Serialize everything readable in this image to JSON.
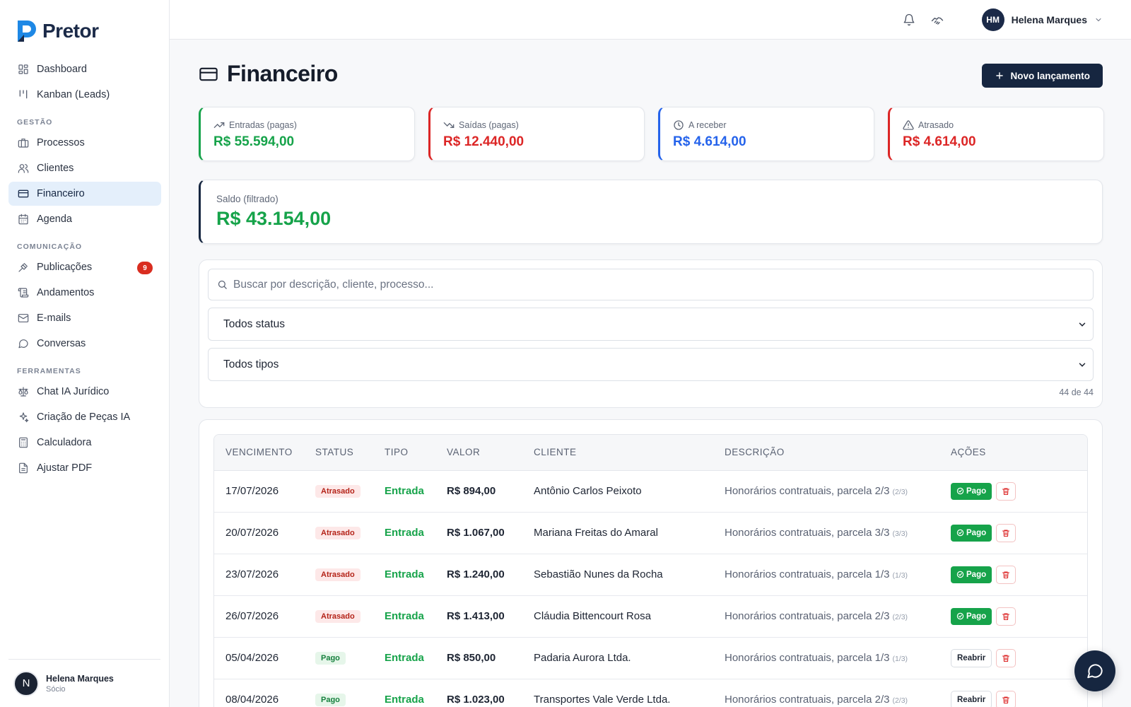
{
  "brand": {
    "name": "Pretor",
    "color": "#1e88e5"
  },
  "colors": {
    "primary": "#162640",
    "green": "#16a34a",
    "red": "#dc2626",
    "blue": "#2563eb"
  },
  "sidebar": {
    "items": [
      {
        "label": "Dashboard",
        "icon": "dashboard-icon"
      },
      {
        "label": "Kanban (Leads)",
        "icon": "kanban-icon"
      }
    ],
    "sections": [
      {
        "title": "GESTÃO",
        "items": [
          {
            "label": "Processos",
            "icon": "briefcase-icon"
          },
          {
            "label": "Clientes",
            "icon": "users-icon"
          },
          {
            "label": "Financeiro",
            "icon": "credit-card-icon",
            "active": true
          },
          {
            "label": "Agenda",
            "icon": "calendar-icon"
          }
        ]
      },
      {
        "title": "COMUNICAÇÃO",
        "items": [
          {
            "label": "Publicações",
            "icon": "gavel-icon",
            "badge": "9"
          },
          {
            "label": "Andamentos",
            "icon": "scroll-icon"
          },
          {
            "label": "E-mails",
            "icon": "mail-icon"
          },
          {
            "label": "Conversas",
            "icon": "chat-icon"
          }
        ]
      },
      {
        "title": "FERRAMENTAS",
        "items": [
          {
            "label": "Chat IA Jurídico",
            "icon": "scale-icon"
          },
          {
            "label": "Criação de Peças IA",
            "icon": "sparkles-icon"
          },
          {
            "label": "Calculadora",
            "icon": "calculator-icon"
          },
          {
            "label": "Ajustar PDF",
            "icon": "file-icon"
          }
        ]
      }
    ],
    "user": {
      "initial": "N",
      "name": "Helena Marques",
      "role": "Sócio"
    }
  },
  "topbar": {
    "user_initials": "HM",
    "user_name": "Helena Marques"
  },
  "page": {
    "title": "Financeiro",
    "new_button": "Novo lançamento"
  },
  "stats": [
    {
      "label": "Entradas (pagas)",
      "value": "R$ 55.594,00",
      "color": "#16a34a",
      "icon": "trending-up-icon"
    },
    {
      "label": "Saídas (pagas)",
      "value": "R$ 12.440,00",
      "color": "#dc2626",
      "icon": "trending-down-icon"
    },
    {
      "label": "A receber",
      "value": "R$ 4.614,00",
      "color": "#2563eb",
      "icon": "clock-icon"
    },
    {
      "label": "Atrasado",
      "value": "R$ 4.614,00",
      "color": "#dc2626",
      "icon": "alert-triangle-icon"
    }
  ],
  "saldo": {
    "label": "Saldo (filtrado)",
    "value": "R$ 43.154,00"
  },
  "filters": {
    "search_placeholder": "Buscar por descrição, cliente, processo...",
    "status_selected": "Todos status",
    "tipo_selected": "Todos tipos",
    "count": "44 de 44"
  },
  "table": {
    "headers": [
      "VENCIMENTO",
      "STATUS",
      "TIPO",
      "VALOR",
      "CLIENTE",
      "DESCRIÇÃO",
      "AÇÕES"
    ],
    "rows": [
      {
        "date": "17/07/2026",
        "status": "Atrasado",
        "tipo": "Entrada",
        "valor": "R$ 894,00",
        "cliente": "Antônio Carlos Peixoto",
        "descricao": "Honorários contratuais, parcela 2/3",
        "parcela": "(2/3)",
        "action": "Pago"
      },
      {
        "date": "20/07/2026",
        "status": "Atrasado",
        "tipo": "Entrada",
        "valor": "R$ 1.067,00",
        "cliente": "Mariana Freitas do Amaral",
        "descricao": "Honorários contratuais, parcela 3/3",
        "parcela": "(3/3)",
        "action": "Pago"
      },
      {
        "date": "23/07/2026",
        "status": "Atrasado",
        "tipo": "Entrada",
        "valor": "R$ 1.240,00",
        "cliente": "Sebastião Nunes da Rocha",
        "descricao": "Honorários contratuais, parcela 1/3",
        "parcela": "(1/3)",
        "action": "Pago"
      },
      {
        "date": "26/07/2026",
        "status": "Atrasado",
        "tipo": "Entrada",
        "valor": "R$ 1.413,00",
        "cliente": "Cláudia Bittencourt Rosa",
        "descricao": "Honorários contratuais, parcela 2/3",
        "parcela": "(2/3)",
        "action": "Pago"
      },
      {
        "date": "05/04/2026",
        "status": "Pago",
        "tipo": "Entrada",
        "valor": "R$ 850,00",
        "cliente": "Padaria Aurora Ltda.",
        "descricao": "Honorários contratuais, parcela 1/3",
        "parcela": "(1/3)",
        "action": "Reabrir"
      },
      {
        "date": "08/04/2026",
        "status": "Pago",
        "tipo": "Entrada",
        "valor": "R$ 1.023,00",
        "cliente": "Transportes Vale Verde Ltda.",
        "descricao": "Honorários contratuais, parcela 2/3",
        "parcela": "(2/3)",
        "action": "Reabrir"
      }
    ]
  }
}
